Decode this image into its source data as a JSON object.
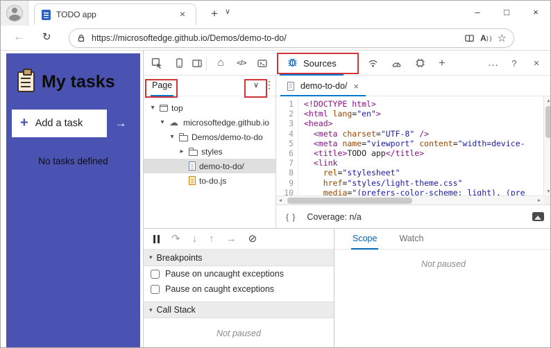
{
  "browser": {
    "tab_title": "TODO app",
    "url": "https://microsoftedge.github.io/Demos/demo-to-do/"
  },
  "app": {
    "title": "My tasks",
    "add_task": "Add a task",
    "empty_message": "No tasks defined"
  },
  "devtools": {
    "toolbar": {
      "sources_label": "Sources"
    },
    "navigator": {
      "tab_label": "Page",
      "tree": [
        {
          "label": "top",
          "depth": 0,
          "arrow": "▾",
          "icon": "frame",
          "selected": false
        },
        {
          "label": "microsoftedge.github.io",
          "depth": 1,
          "arrow": "▾",
          "icon": "cloud",
          "selected": false
        },
        {
          "label": "Demos/demo-to-do",
          "depth": 2,
          "arrow": "▾",
          "icon": "folder",
          "selected": false
        },
        {
          "label": "styles",
          "depth": 3,
          "arrow": "▸",
          "icon": "folder",
          "selected": false
        },
        {
          "label": "demo-to-do/",
          "depth": 3,
          "arrow": "",
          "icon": "file",
          "selected": true
        },
        {
          "label": "to-do.js",
          "depth": 3,
          "arrow": "",
          "icon": "file-js",
          "selected": false
        }
      ]
    },
    "editor": {
      "tab_label": "demo-to-do/",
      "coverage": "Coverage: n/a",
      "code": [
        [
          [
            "t",
            "<!DOCTYPE html>"
          ]
        ],
        [
          [
            "t",
            "<html"
          ],
          [
            "a",
            " lang"
          ],
          [
            "p",
            "="
          ],
          [
            "s",
            "\"en\""
          ],
          [
            "t",
            ">"
          ]
        ],
        [
          [
            "t",
            "<head>"
          ]
        ],
        [
          [
            "x",
            "  "
          ],
          [
            "t",
            "<meta"
          ],
          [
            "a",
            " charset"
          ],
          [
            "p",
            "="
          ],
          [
            "s",
            "\"UTF-8\""
          ],
          [
            "t",
            " />"
          ]
        ],
        [
          [
            "x",
            "  "
          ],
          [
            "t",
            "<meta"
          ],
          [
            "a",
            " name"
          ],
          [
            "p",
            "="
          ],
          [
            "s",
            "\"viewport\""
          ],
          [
            "a",
            " content"
          ],
          [
            "p",
            "="
          ],
          [
            "s",
            "\"width=device-"
          ]
        ],
        [
          [
            "x",
            "  "
          ],
          [
            "t",
            "<title>"
          ],
          [
            "x",
            "TODO app"
          ],
          [
            "t",
            "</title>"
          ]
        ],
        [
          [
            "x",
            "  "
          ],
          [
            "t",
            "<link"
          ]
        ],
        [
          [
            "x",
            "    "
          ],
          [
            "a",
            "rel"
          ],
          [
            "p",
            "="
          ],
          [
            "s",
            "\"stylesheet\""
          ]
        ],
        [
          [
            "x",
            "    "
          ],
          [
            "a",
            "href"
          ],
          [
            "p",
            "="
          ],
          [
            "s",
            "\"styles/light-theme.css\""
          ]
        ],
        [
          [
            "x",
            "    "
          ],
          [
            "a",
            "media"
          ],
          [
            "p",
            "="
          ],
          [
            "s",
            "\"(prefers-color-scheme: light), (pre"
          ]
        ]
      ]
    },
    "debugger": {
      "breakpoints_title": "Breakpoints",
      "checkboxes": [
        "Pause on uncaught exceptions",
        "Pause on caught exceptions"
      ],
      "call_stack_title": "Call Stack",
      "status": "Not paused"
    },
    "scope_pane": {
      "tabs": [
        "Scope",
        "Watch"
      ],
      "status": "Not paused"
    }
  },
  "icons": {
    "minimize": "–",
    "maximize": "□",
    "close": "×",
    "back": "←",
    "refresh": "↻",
    "star": "☆",
    "new_tab": "+",
    "chevron_down": "∨",
    "more_vertical": "⋮",
    "more_horizontal": "…",
    "help": "?",
    "home": "⌂",
    "elements": "</>",
    "plus": "+",
    "caret_down": "▾",
    "scroll_up": "▲",
    "scroll_down": "▼",
    "scroll_left": "◀",
    "scroll_right": "▶",
    "step_over": "↷",
    "step_into": "↓",
    "step_out": "↑",
    "step": "→",
    "deactivate_breakpoints": "⊘",
    "braces": "{ }",
    "add": "+",
    "arrow_right": "→",
    "read_aloud_letter": "A",
    "cloud": "☁"
  },
  "colors": {
    "accent_blue": "#0078d4",
    "app_indigo": "#4a53b2",
    "annotation_red": "#d13438"
  }
}
